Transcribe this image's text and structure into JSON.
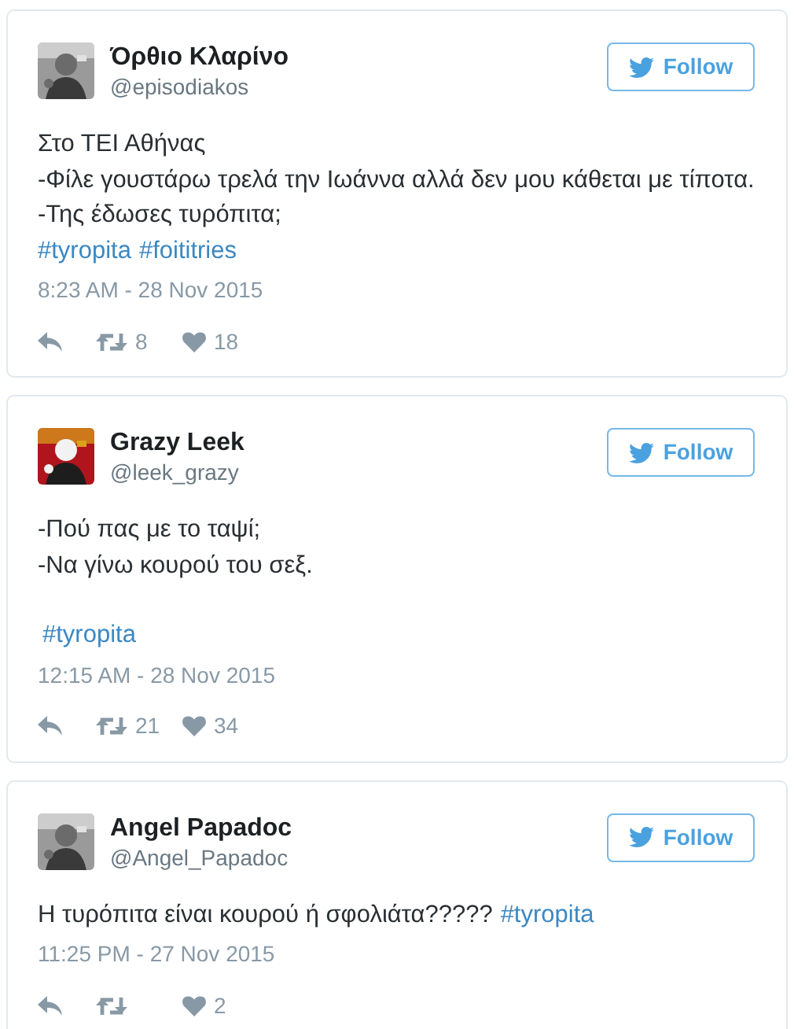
{
  "tweets": [
    {
      "name": "Όρθιο Κλαρίνο",
      "handle": "@episodiakos",
      "avatar": {
        "kind": "picture"
      },
      "follow": "Follow",
      "lines": [
        {
          "segments": [
            {
              "kind": "text",
              "text": "Στο ΤΕΙ Αθήνας"
            }
          ]
        },
        {
          "segments": [
            {
              "kind": "text",
              "text": "-Φίλε γουστάρω τρελά την Ιωάννα αλλά δεν μου κάθεται με τίποτα."
            }
          ]
        },
        {
          "segments": [
            {
              "kind": "text",
              "text": "-Της έδωσες τυρόπιτα;"
            }
          ]
        },
        {
          "segments": [
            {
              "kind": "hashtag",
              "text": "#tyropita"
            },
            {
              "kind": "hashtag",
              "text": "#foititries"
            }
          ]
        }
      ],
      "time": "8:23 AM - 28 Nov 2015",
      "retweets": "8",
      "likes": "18"
    },
    {
      "name": "Grazy Leek",
      "handle": "@leek_grazy",
      "avatar": {
        "kind": "picture"
      },
      "follow": "Follow",
      "lines": [
        {
          "segments": [
            {
              "kind": "text",
              "text": "-Πού πας με το ταψί;"
            }
          ]
        },
        {
          "segments": [
            {
              "kind": "text",
              "text": "-Να γίνω κουρού του σεξ."
            }
          ]
        },
        {
          "gap_before": true,
          "segments": [
            {
              "kind": "hashtag",
              "text": "#tyropita"
            }
          ]
        }
      ],
      "time": "12:15 AM - 28 Nov 2015",
      "retweets": "21",
      "likes": "34"
    },
    {
      "name": "Angel Papadoc",
      "handle": "@Angel_Papadoc",
      "avatar": {
        "kind": "picture"
      },
      "follow": "Follow",
      "lines": [
        {
          "segments": [
            {
              "kind": "text",
              "text": "Η τυρόπιτα είναι κουρού ή σφολιάτα?????"
            },
            {
              "kind": "hashtag",
              "text": "#tyropita"
            }
          ]
        }
      ],
      "time": "11:25 PM - 27 Nov 2015",
      "likes": "2"
    }
  ]
}
